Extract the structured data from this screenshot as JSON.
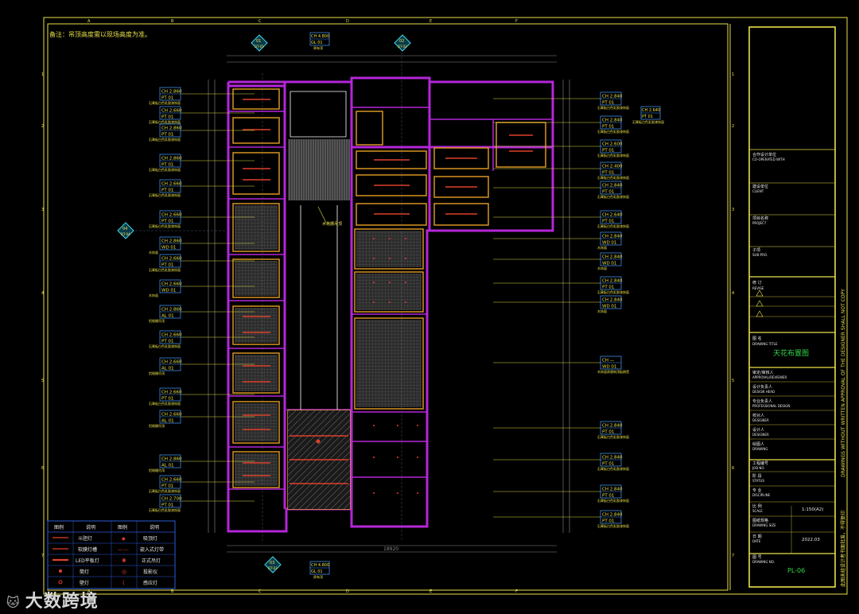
{
  "note": "备注：吊顶高度需以现场高度为准。",
  "grid": {
    "top_letters": [
      "A",
      "B",
      "C",
      "D",
      "E",
      "F"
    ],
    "side_numbers": [
      "1",
      "2",
      "3",
      "4",
      "5",
      "6",
      "7"
    ]
  },
  "section_markers": [
    {
      "id": "01",
      "ref": "DT-01"
    },
    {
      "id": "02",
      "ref": "DT-02"
    },
    {
      "id": "03",
      "ref": "DT-03"
    },
    {
      "id": "04",
      "ref": "DT-04"
    }
  ],
  "top_tag": {
    "ch": "CH 4.800",
    "gl": "GL 01",
    "note": "原有顶"
  },
  "bottom_tag": {
    "ch": "CH 4.800",
    "gl": "GL 01",
    "note": "原有顶"
  },
  "left_tags": [
    {
      "ch": "CH 2.860",
      "code": "PT  01",
      "note": "石膏板白色乳胶漆饰面"
    },
    {
      "ch": "CH 2.660",
      "code": "PT  01",
      "note": "石膏板白色乳胶漆饰面"
    },
    {
      "ch": "CH 2.860",
      "code": "PT  01",
      "note": "石膏板白色乳胶漆饰面"
    },
    {
      "ch": "CH 2.860",
      "code": "PT  01",
      "note": "石膏板白色乳胶漆饰面"
    },
    {
      "ch": "CH 2.660",
      "code": "PT  01",
      "note": "石膏板白色乳胶漆饰面"
    },
    {
      "ch": "CH 2.660",
      "code": "PT  01",
      "note": "石膏板白色乳胶漆饰面"
    },
    {
      "ch": "CH 2.860",
      "code": "WD  01",
      "note": "木饰面"
    },
    {
      "ch": "CH 2.660",
      "code": "PT  01",
      "note": "石膏板白色乳胶漆饰面"
    },
    {
      "ch": "CH 2.660",
      "code": "WD  01",
      "note": "木饰面"
    },
    {
      "ch": "CH 2.860",
      "code": "AL  01",
      "note": "铝格栅吊顶"
    },
    {
      "ch": "CH 2.660",
      "code": "PT  01",
      "note": "石膏板白色乳胶漆饰面"
    },
    {
      "ch": "CH 2.660",
      "code": "AL  01",
      "note": "铝格栅吊顶"
    },
    {
      "ch": "CH 2.660",
      "code": "PT  01",
      "note": "石膏板白色乳胶漆饰面"
    },
    {
      "ch": "CH 2.660",
      "code": "AL  01",
      "note": "铝格栅吊顶"
    },
    {
      "ch": "CH 2.860",
      "code": "AL  01",
      "note": "铝格栅吊顶"
    },
    {
      "ch": "CH 2.660",
      "code": "PT  01",
      "note": "石膏板白色乳胶漆饰面"
    },
    {
      "ch": "CH 2.700",
      "code": "PT  01",
      "note": "石膏板白色乳胶漆饰面"
    }
  ],
  "right_tags": [
    {
      "ch": "CH 2.840",
      "code": "PT  01",
      "note": "石膏板白色乳胶漆饰面"
    },
    {
      "ch": "CH 2.840",
      "code": "PT  01",
      "note": "石膏板白色乳胶漆饰面"
    },
    {
      "ch": "CH 2.600",
      "code": "PT  01",
      "note": "石膏板白色乳胶漆饰面"
    },
    {
      "ch": "CH 2.400",
      "code": "PT  01",
      "note": "石膏板白色乳胶漆饰面"
    },
    {
      "ch": "CH 2.840",
      "code": "PT  01",
      "note": "石膏板白色乳胶漆饰面"
    },
    {
      "ch": "CH 2.640",
      "code": "PT  01",
      "note": "石膏板白色乳胶漆饰面"
    },
    {
      "ch": "CH 2.840",
      "code": "WD  01",
      "note": "木饰面"
    },
    {
      "ch": "CH 2.840",
      "code": "WD  01",
      "note": "木饰面"
    },
    {
      "ch": "CH 2.840",
      "code": "PT  01",
      "note": "石膏板白色乳胶漆饰面"
    },
    {
      "ch": "CH 2.840",
      "code": "WD  01",
      "note": "木饰面"
    },
    {
      "ch": "CH —",
      "code": "WD  01",
      "note": "木饰面原建筑顶板刷黑"
    },
    {
      "ch": "CH 2.840",
      "code": "PT  01",
      "note": "石膏板白色乳胶漆饰面"
    },
    {
      "ch": "CH 2.840",
      "code": "PT  01",
      "note": "石膏板白色乳胶漆饰面"
    },
    {
      "ch": "CH 2.840",
      "code": "PT  01",
      "note": "石膏板白色乳胶漆饰面"
    },
    {
      "ch": "CH 2.840",
      "code": "PT  01",
      "note": "石膏板白色乳胶漆饰面"
    }
  ],
  "extra_tag": {
    "ch": "CH 2.640",
    "code": "PT  01",
    "note": "石膏板白色乳胶漆饰面"
  },
  "plan_labels": {
    "louver": "木格栅吊顶"
  },
  "dimensions": {
    "bottom_total": "18920"
  },
  "legend": {
    "headers": [
      "图例",
      "说明",
      "图例",
      "说明"
    ],
    "rows": [
      [
        "斗胆灯",
        "◆",
        "吸顶灯"
      ],
      [
        "软膜灯槽",
        "—·—",
        "嵌入式灯带"
      ],
      [
        "LED平板灯",
        "✺",
        "正式吊灯"
      ],
      [
        "筒灯",
        "◎",
        "投影仪"
      ],
      [
        "壁灯",
        "(",
        "感应灯"
      ]
    ]
  },
  "title_block": {
    "blank": "",
    "fields": [
      {
        "cn": "合作设计单位",
        "en": "CO-OPERATED WITH",
        "value": ""
      },
      {
        "cn": "建设单位",
        "en": "CLIENT",
        "value": ""
      },
      {
        "cn": "项目名称",
        "en": "PROJECT",
        "value": ""
      },
      {
        "cn": "子项",
        "en": "SUB-PRO.",
        "value": ""
      }
    ],
    "revise_cn": "修 订",
    "revise_en": "REVISE",
    "drawing_title_cn": "图 名",
    "drawing_title_en": "DRAWING TITLE",
    "drawing_title": "天花布置图",
    "approvals": [
      {
        "cn": "审定/审核人",
        "en": "APPROVAL/REVIEWER"
      },
      {
        "cn": "设计负责人",
        "en": "DESIGN HEAD"
      },
      {
        "cn": "专业负责人",
        "en": "PROFESSIONAL DESIGN"
      },
      {
        "cn": "校对人",
        "en": "DESIGNER"
      },
      {
        "cn": "设计人",
        "en": "DESIGNER"
      },
      {
        "cn": "绘图人",
        "en": "DRAWING"
      }
    ],
    "info": [
      {
        "cn": "工程编号",
        "en": "JOB NO.",
        "value": ""
      },
      {
        "cn": "阶 段",
        "en": "STATUS",
        "value": ""
      },
      {
        "cn": "专 业",
        "en": "DISCIPLINE",
        "value": ""
      },
      {
        "cn": "比 例",
        "en": "SCALE",
        "value": "1:150(A2)"
      },
      {
        "cn": "图纸规格",
        "en": "DRAWING SIZE",
        "value": ""
      },
      {
        "cn": "日 期",
        "en": "DATE",
        "value": "2022.03"
      },
      {
        "cn": "图 号",
        "en": "DRAWING NO.",
        "value": "PL-06"
      }
    ],
    "vertical_text": "DRAWINGS WITHOUT WRITTEN APPROVAL OF THE DESIGNER SHALL NOT COPY",
    "vertical_text_cn": "此图未经设计者书面批准，不得复印"
  },
  "watermark": {
    "logo": "🐱",
    "text": "大数跨境"
  },
  "colors": {
    "frame": "#e8e04a",
    "wall": "#b426d8",
    "room": "#d89422",
    "tag": "#3f8de6",
    "leader": "#d8d84a",
    "dim": "#8a8a8a",
    "legend": "#2a5bd6",
    "title_text": "#32d84a"
  }
}
